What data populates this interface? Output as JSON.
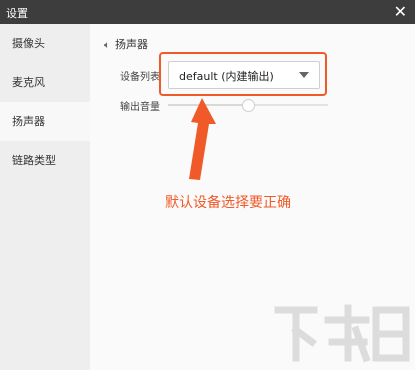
{
  "window": {
    "title": "设置"
  },
  "sidebar": {
    "items": [
      {
        "label": "摄像头"
      },
      {
        "label": "麦克风"
      },
      {
        "label": "扬声器",
        "active": true
      },
      {
        "label": "链路类型"
      }
    ]
  },
  "speaker": {
    "section_title": "扬声器",
    "device_list_label": "设备列表",
    "device_selected": "default (内建输出)",
    "volume_label": "输出音量",
    "volume_level": 0.5
  },
  "annotation": {
    "text": "默认设备选择要正确",
    "color": "#f05a28"
  },
  "watermark": {
    "text": "下载吧"
  }
}
